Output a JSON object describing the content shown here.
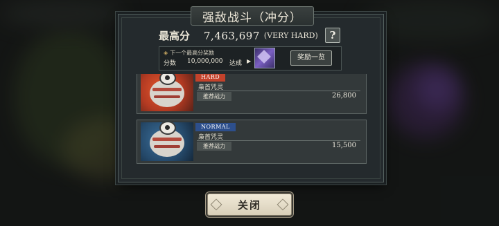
{
  "dialog": {
    "title": "强敌战斗（冲分）",
    "best_score_label": "最高分",
    "best_score_value": "7,463,697",
    "best_score_difficulty": "(VERY HARD)",
    "help_label": "?"
  },
  "reward": {
    "next_label": "下一个最高分奖励",
    "score_label": "分数",
    "score_target": "10,000,000",
    "reach_label": "达成",
    "list_button": "奖励一览"
  },
  "stages": [
    {
      "difficulty": "HARD",
      "name": "枭首咒灵",
      "power_label": "推荐战力",
      "power_value": "26,800"
    },
    {
      "difficulty": "NORMAL",
      "name": "枭首咒灵",
      "power_label": "推荐战力",
      "power_value": "15,500"
    }
  ],
  "close_button": "关闭",
  "colors": {
    "hard_badge": "#c3422b",
    "normal_badge": "#2d4f8c",
    "accent_gold": "#c9a962"
  }
}
